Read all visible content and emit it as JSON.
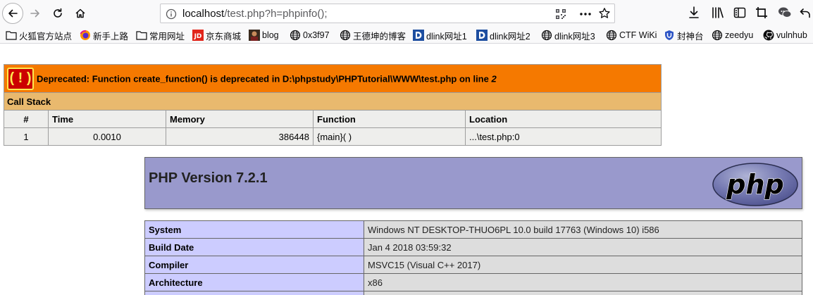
{
  "browser": {
    "url_host": "localhost",
    "url_path": "/test.php?h=phpinfo();",
    "bookmarks": [
      {
        "label": "火狐官方站点",
        "icon": "folder-icon"
      },
      {
        "label": "新手上路",
        "icon": "firefox-icon"
      },
      {
        "label": "常用网址",
        "icon": "folder-icon"
      },
      {
        "label": "京东商城",
        "icon": "jd-icon"
      },
      {
        "label": "blog",
        "icon": "avatar-icon"
      },
      {
        "label": "0x3f97",
        "icon": "globe-icon"
      },
      {
        "label": "王德坤的博客",
        "icon": "globe-icon"
      },
      {
        "label": "dlink网址1",
        "icon": "dlink-icon"
      },
      {
        "label": "dlink网址2",
        "icon": "dlink-icon"
      },
      {
        "label": "dlink网址3",
        "icon": "globe-icon"
      },
      {
        "label": "CTF WiKi",
        "icon": "globe-icon"
      },
      {
        "label": "封神台",
        "icon": "shield-icon"
      },
      {
        "label": "zeedyu",
        "icon": "globe-icon"
      },
      {
        "label": "vulnhub",
        "icon": "github-icon"
      }
    ]
  },
  "xdebug": {
    "badge": "( ! )",
    "message": "Deprecated: Function create_function() is deprecated in D:\\phpstudy\\PHPTutorial\\WWW\\test.php on line",
    "line": "2",
    "call_stack_label": "Call Stack",
    "columns": [
      "#",
      "Time",
      "Memory",
      "Function",
      "Location"
    ],
    "rows": [
      {
        "num": "1",
        "time": "0.0010",
        "memory": "386448",
        "function": "{main}( )",
        "location": "...\\test.php:0"
      }
    ],
    "colors": {
      "error_bg": "#f57900",
      "callstack_bg": "#e9b96e",
      "cell_bg": "#eeeeec"
    }
  },
  "phpinfo": {
    "title": "PHP Version 7.2.1",
    "logo_text": "php",
    "rows": [
      {
        "key": "System",
        "value": "Windows NT DESKTOP-THUO6PL 10.0 build 17763 (Windows 10) i586"
      },
      {
        "key": "Build Date",
        "value": "Jan 4 2018 03:59:32"
      },
      {
        "key": "Compiler",
        "value": "MSVC15 (Visual C++ 2017)"
      },
      {
        "key": "Architecture",
        "value": "x86"
      },
      {
        "key": "",
        "value": ""
      }
    ],
    "colors": {
      "header_bg": "#9999cc",
      "key_bg": "#ccccff",
      "value_bg": "#dddddd"
    }
  }
}
